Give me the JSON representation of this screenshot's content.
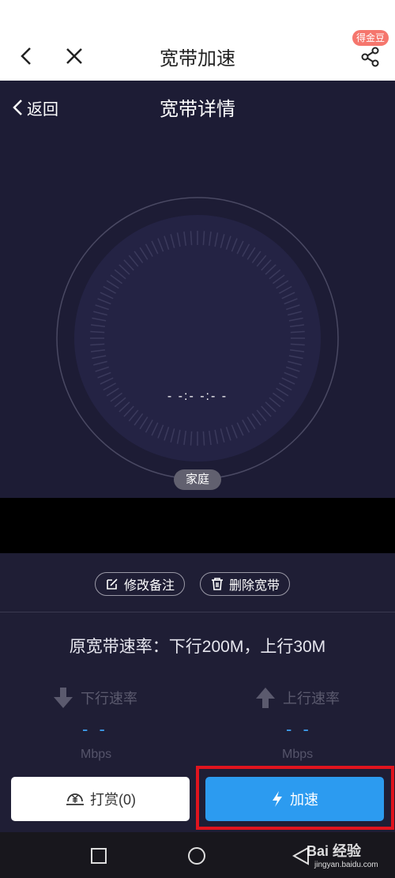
{
  "topbar": {
    "title": "宽带加速",
    "badge": "得金豆"
  },
  "detail": {
    "back_label": "返回",
    "title": "宽带详情"
  },
  "gauge": {
    "speed_text": "- -:- -:- -",
    "tag": "家庭"
  },
  "actions": {
    "edit_label": "修改备注",
    "delete_label": "删除宽带"
  },
  "rate_text": "原宽带速率：下行200M，上行30M",
  "download": {
    "label": "下行速率",
    "value": "- -",
    "unit": "Mbps"
  },
  "upload": {
    "label": "上行速率",
    "value": "- -",
    "unit": "Mbps"
  },
  "buttons": {
    "tip_label": "打赏(0)",
    "accelerate_label": "加速"
  },
  "watermark": {
    "logo": "Bai 经验",
    "url": "jingyan.baidu.com"
  },
  "colors": {
    "accent": "#2c9bf0",
    "highlight": "#e0141e",
    "dark_bg": "#1d1c35"
  }
}
